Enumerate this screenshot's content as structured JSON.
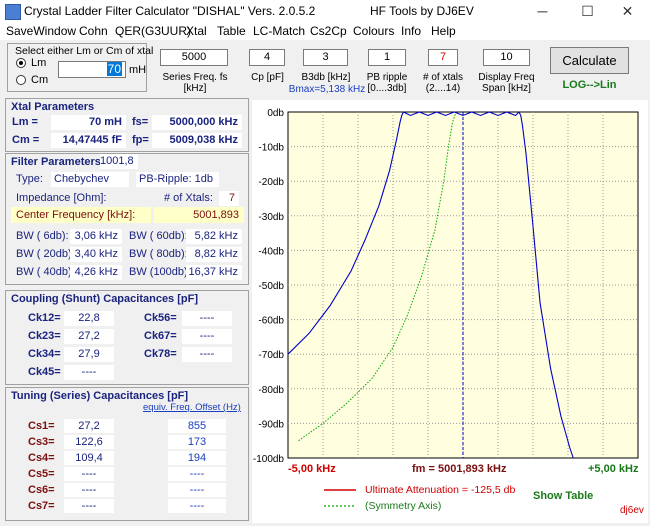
{
  "window": {
    "title": "Crystal Ladder Filter Calculator  \"DISHAL\"  Vers. 2.0.5.2",
    "title_right": "HF Tools by DJ6EV",
    "minimize": "─",
    "maximize": "☐",
    "close": "✕"
  },
  "menu": [
    "SaveWindow",
    "Cohn",
    "QER(G3UUR)",
    "Xtal",
    "Table",
    "LC-Match",
    "Cs2Cp",
    "Colours",
    "Info",
    "Help"
  ],
  "select_group": {
    "title": "Select either Lm or Cm of xtal",
    "opt_lm": "Lm",
    "opt_cm": "Cm",
    "value": "70",
    "unit": "mH"
  },
  "inputs": [
    {
      "value": "5000",
      "label": "Series Freq. fs [kHz]",
      "label2": ""
    },
    {
      "value": "4",
      "label": "Cp [pF]",
      "label2": ""
    },
    {
      "value": "3",
      "label": "B3db [kHz]",
      "label2": "Bmax=5,138 kHz"
    },
    {
      "value": "1",
      "label": "PB ripple",
      "label2": "[0....3db]"
    },
    {
      "value": "7",
      "label": "# of xtals",
      "label2": "(2....14)"
    },
    {
      "value": "10",
      "label": "Display Freq",
      "label2": "Span [kHz]"
    }
  ],
  "calculate_button": "Calculate",
  "log_lin": "LOG-->Lin",
  "xtal": {
    "title": "Xtal Parameters",
    "lm_label": "Lm =",
    "lm_value": "70 mH",
    "fs_label": "fs=",
    "fs_value": "5000,000 kHz",
    "cm_label": "Cm =",
    "cm_value": "14,47445  fF",
    "fp_label": "fp=",
    "fp_value": "5009,038 kHz"
  },
  "filter": {
    "title": "Filter Parameters",
    "type_label": "Type:",
    "type_value": "Chebychev",
    "ripple_label": "PB-Ripple: 1db",
    "impedance_label": "Impedance [Ohm]:",
    "impedance_value": "1001,8",
    "xtals_label": "# of Xtals:",
    "xtals_value": "7",
    "center_label": "Center Frequency [kHz]:",
    "center_value": "5001,893",
    "bw": [
      {
        "l": "BW (  6db):",
        "v": "3,06 kHz",
        "l2": "BW ( 60db):",
        "v2": "5,82 kHz"
      },
      {
        "l": "BW ( 20db):",
        "v": "3,40 kHz",
        "l2": "BW ( 80db):",
        "v2": "8,82 kHz"
      },
      {
        "l": "BW ( 40db):",
        "v": "4,26 kHz",
        "l2": "BW (100db):",
        "v2": "16,37 kHz"
      }
    ]
  },
  "coupling": {
    "title": "Coupling (Shunt) Capacitances [pF]",
    "rows": [
      {
        "l": "Ck12=",
        "v": "22,8",
        "l2": "Ck56=",
        "v2": "----"
      },
      {
        "l": "Ck23=",
        "v": "27,2",
        "l2": "Ck67=",
        "v2": "----"
      },
      {
        "l": "Ck34=",
        "v": "27,9",
        "l2": "Ck78=",
        "v2": "----"
      },
      {
        "l": "Ck45=",
        "v": "----",
        "l2": "",
        "v2": ""
      }
    ]
  },
  "tuning": {
    "title": "Tuning (Series) Capacitances [pF]",
    "link": "equiv. Freq. Offset (Hz)",
    "rows": [
      {
        "l": "Cs1=",
        "v": "27,2",
        "o": "855"
      },
      {
        "l": "Cs3=",
        "v": "122,6",
        "o": "173"
      },
      {
        "l": "Cs4=",
        "v": "109,4",
        "o": "194"
      },
      {
        "l": "Cs5=",
        "v": "----",
        "o": "----"
      },
      {
        "l": "Cs6=",
        "v": "----",
        "o": "----"
      },
      {
        "l": "Cs7=",
        "v": "----",
        "o": "----"
      }
    ]
  },
  "chart_data": {
    "type": "line",
    "ylim": [
      -100,
      0
    ],
    "xlim": [
      -5,
      5
    ],
    "y_ticks": [
      "0db",
      "-10db",
      "-20db",
      "-30db",
      "-40db",
      "-50db",
      "-60db",
      "-70db",
      "-80db",
      "-90db",
      "-100db"
    ],
    "x_left_label": "-5,00 kHz",
    "x_center_label": "fm = 5001,893 kHz",
    "x_right_label": "+5,00 kHz",
    "series": [
      {
        "name": "Ultimate Attenuation =  -125,5 db",
        "x": [
          -5.0,
          -4.4,
          -3.8,
          -3.2,
          -2.8,
          -2.4,
          -2.1,
          -1.9,
          -1.8,
          -1.75,
          -1.7,
          -1.5,
          -1.25,
          -1.0,
          -0.75,
          -0.5,
          -0.25,
          0.0,
          0.25,
          0.5,
          0.75,
          1.0,
          1.25,
          1.5,
          1.6,
          1.65,
          1.7,
          1.8,
          2.0,
          2.2,
          2.5,
          2.8,
          3.05,
          3.15
        ],
        "y": [
          -70,
          -64,
          -56,
          -46,
          -37,
          -27,
          -17,
          -8,
          -3,
          -1,
          0,
          -1,
          0,
          -1,
          0,
          -1,
          0,
          -1,
          0,
          -1,
          0,
          -1,
          0,
          -1,
          0,
          -1,
          -4,
          -12,
          -33,
          -55,
          -74,
          -88,
          -97,
          -100
        ]
      },
      {
        "name": "(Symmetry Axis)",
        "x": [
          -4.7,
          -4.0,
          -3.3,
          -2.6,
          -2.0,
          -1.6,
          -1.2,
          -0.8,
          -0.55,
          -0.4,
          -0.3,
          -0.2
        ],
        "y": [
          -95,
          -90,
          -84,
          -77,
          -68,
          -59,
          -48,
          -34,
          -20,
          -9,
          -3,
          0
        ]
      }
    ],
    "colors": {
      "attenuation": "#0000cc",
      "symmetry": "#00aa00",
      "center": "#0000cc",
      "grid": "#9a9a9a",
      "plot_bg": "#ffffe0"
    },
    "show_table": "Show Table",
    "credit": "dj6ev"
  }
}
